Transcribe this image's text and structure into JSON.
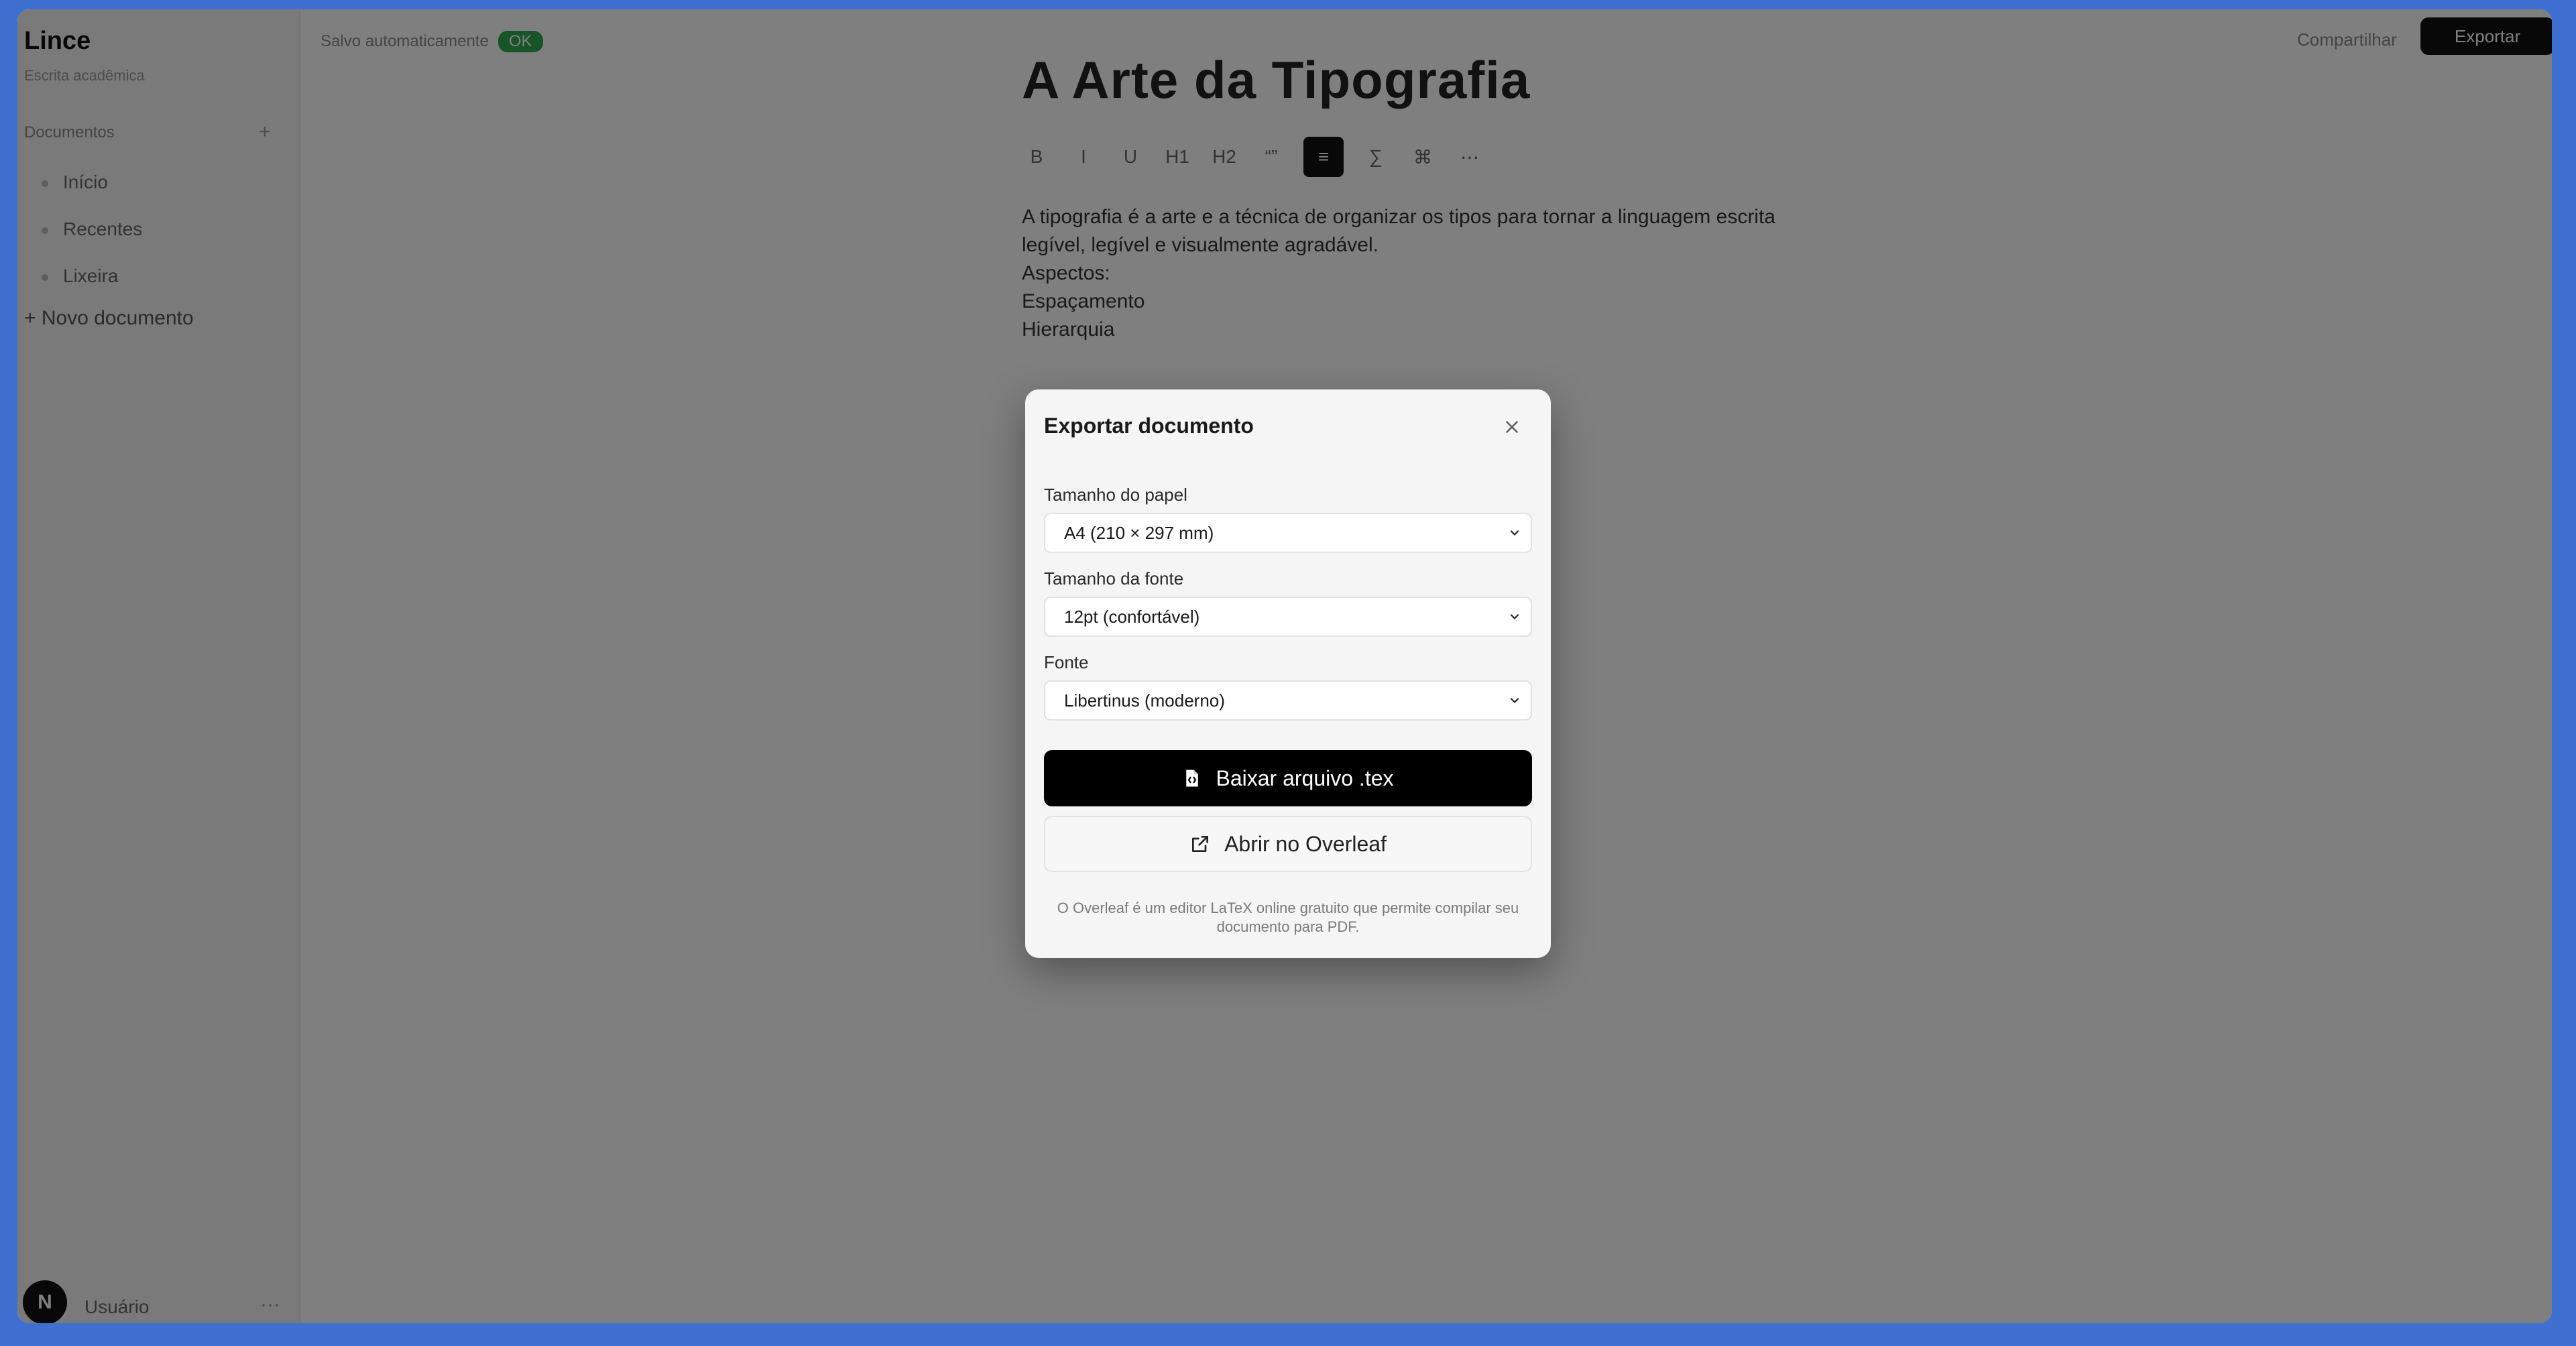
{
  "app": {
    "logo": "Lince",
    "logo_sub": "Escrita acadêmica",
    "section_title": "Documentos",
    "nav_items": [
      "Início",
      "Recentes",
      "Lixeira"
    ],
    "nav_add": "+ Novo documento",
    "user_initial": "N",
    "user_name": "Usuário",
    "status_text": "Salvo automaticamente",
    "status_badge": "OK",
    "share_label": "Compartilhar",
    "export_label": "Exportar"
  },
  "editor": {
    "title": "A Arte da Tipografia",
    "toolbar": [
      "B",
      "I",
      "U",
      "H1",
      "H2",
      "“”",
      "≡",
      "∑",
      "⌘",
      "⋯"
    ],
    "lines": [
      "A tipografia é a arte e a técnica de organizar os tipos para tornar a linguagem escrita",
      "legível, legível e visualmente agradável.",
      "Aspectos:",
      "Espaçamento",
      "Hierarquia"
    ]
  },
  "modal": {
    "title": "Exportar documento",
    "paper_label": "Tamanho do papel",
    "paper_value": "A4 (210 × 297 mm)",
    "font_size_label": "Tamanho da fonte",
    "font_size_value": "12pt (confortável)",
    "font_label": "Fonte",
    "font_value": "Libertinus (moderno)",
    "download_label": "Baixar arquivo .tex",
    "overleaf_label": "Abrir no Overleaf",
    "note": "O Overleaf é um editor LaTeX online gratuito que permite compilar seu documento para PDF."
  },
  "icons": {
    "close": "close-icon",
    "chevron": "chevron-down-icon",
    "file_code": "file-code-icon",
    "external_link": "external-link-icon"
  }
}
